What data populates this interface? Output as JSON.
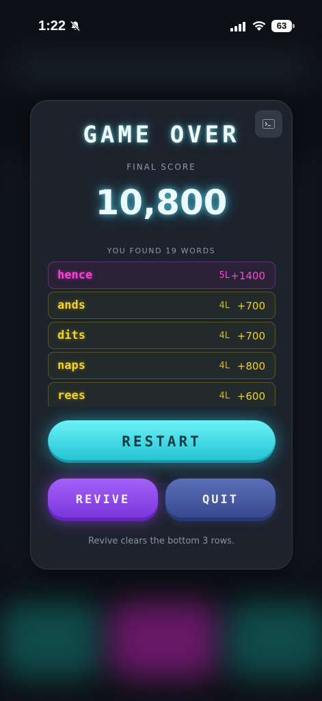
{
  "status_bar": {
    "time": "1:22",
    "battery": "63"
  },
  "modal": {
    "title": "GAME OVER",
    "final_score_label": "FINAL SCORE",
    "score": "10,800",
    "words_found_label": "YOU FOUND 19 WORDS",
    "words": [
      {
        "word": "hence",
        "length": "5L",
        "points": "+1400",
        "color": "#ff3fd9"
      },
      {
        "word": "ands",
        "length": "4L",
        "points": "+700",
        "color": "#f1d327"
      },
      {
        "word": "dits",
        "length": "4L",
        "points": "+700",
        "color": "#f1d327"
      },
      {
        "word": "naps",
        "length": "4L",
        "points": "+800",
        "color": "#f1d327"
      },
      {
        "word": "rees",
        "length": "4L",
        "points": "+600",
        "color": "#f1d327"
      }
    ],
    "restart_label": "RESTART",
    "revive_label": "REVIVE",
    "quit_label": "QUIT",
    "hint": "Revive clears the bottom 3 rows."
  },
  "colors": {
    "accent_cyan": "#2fd3e0",
    "revive_purple": "#9a52f3",
    "quit_blue": "#4a5ca8",
    "word_gold": "#f1d327",
    "word_magenta": "#ff3fd9"
  },
  "icons": [
    "bell-slash-icon",
    "signal-icon",
    "wifi-icon",
    "battery-icon",
    "terminal-icon"
  ]
}
